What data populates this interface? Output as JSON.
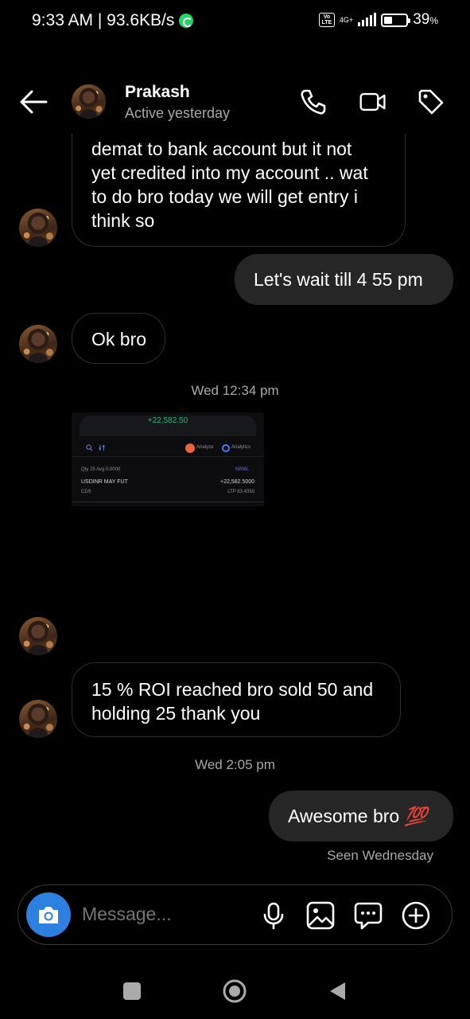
{
  "status_bar": {
    "time_speed": "9:33 AM | 93.6KB/s",
    "volte": "Vo LTE",
    "network": "4G+",
    "battery_pct": "39",
    "battery_unit": "%",
    "battery_level": 0.39
  },
  "header": {
    "contact_name": "Prakash",
    "contact_status": "Active yesterday"
  },
  "messages": {
    "m1_line1": "demat to bank account but it not",
    "m1_line2": "yet credited into my account .. wat",
    "m1_line3": "to do bro today we will get entry i",
    "m1_line4": "think so",
    "m2": "Let's wait till 4 55 pm",
    "m3": "Ok bro",
    "ts1": "Wed 12:34 pm",
    "m5_line1": "15 % ROI reached bro sold 50 and",
    "m5_line2": "holding 25 thank you",
    "ts2": "Wed 2:05 pm",
    "m6": "Awesome bro",
    "m6_emoji": "💯",
    "seen": "Seen Wednesday"
  },
  "attachment": {
    "pnl": "+22,582.50",
    "analyze": "Analyze",
    "analytics": "Analytics",
    "filter_text": "Qty 25  Avg 0.0000",
    "tag": "NRML",
    "symbol": "USDINR MAY FUT",
    "exchange": "CDS",
    "row_pnl": "+22,582.5000",
    "ltp": "LTP 83.4350"
  },
  "composer": {
    "placeholder": "Message..."
  }
}
